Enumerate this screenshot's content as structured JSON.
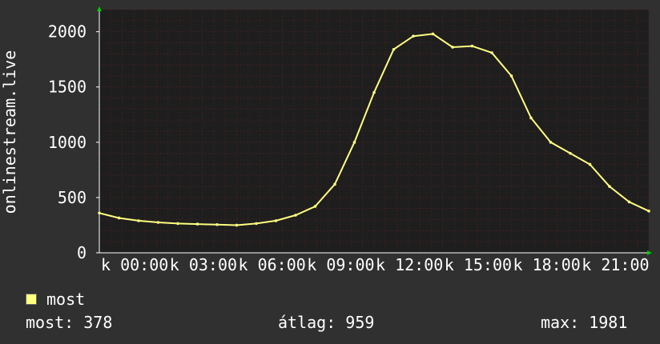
{
  "chart_data": {
    "type": "line",
    "title": "",
    "xlabel": "",
    "ylabel": "onlinestream.live",
    "ylim": [
      0,
      2200
    ],
    "yticks": [
      0,
      500,
      1000,
      1500,
      2000
    ],
    "ytick_labels": [
      "0",
      "500",
      "1000",
      "1500",
      "2000"
    ],
    "xtick_labels": [
      "k 00:00",
      "k 03:00",
      "k 06:00",
      "k 09:00",
      "k 12:00",
      "k 15:00",
      "k 18:00",
      "k 21:00"
    ],
    "grid": true,
    "legend": "bottom-left",
    "series": [
      {
        "name": "most",
        "color": "#ffff80",
        "x": [
          "20:00",
          "21:00",
          "22:00",
          "23:00",
          "00:00",
          "01:00",
          "02:00",
          "03:00",
          "04:00",
          "05:00",
          "06:00",
          "07:00",
          "08:00",
          "09:00",
          "10:00",
          "11:00",
          "12:00",
          "13:00",
          "14:00",
          "15:00",
          "16:00",
          "17:00",
          "18:00",
          "19:00",
          "20:00",
          "21:00",
          "22:00",
          "23:00",
          "23:59"
        ],
        "values": [
          360,
          315,
          290,
          275,
          265,
          260,
          255,
          250,
          265,
          290,
          340,
          420,
          620,
          1000,
          1450,
          1840,
          1960,
          1980,
          1860,
          1870,
          1810,
          1600,
          1220,
          1000,
          900,
          800,
          600,
          460,
          378
        ]
      }
    ]
  },
  "legend": {
    "label": "most",
    "color": "#ffff80"
  },
  "stats": {
    "current": "most: 378",
    "average": "átlag: 959",
    "max": "max: 1981"
  },
  "colors": {
    "background": "#303030",
    "plot_background": "#1e1e1e",
    "grid_minor": "#5a1e1e",
    "axis": "#ffffff",
    "axis_arrow": "#00cc00"
  }
}
